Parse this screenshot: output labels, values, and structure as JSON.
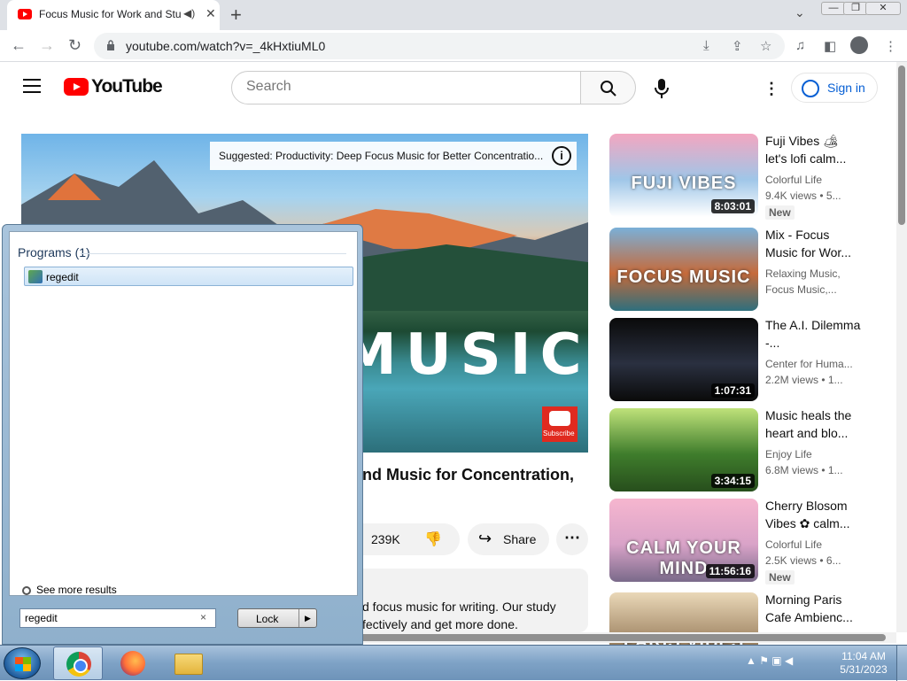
{
  "browser": {
    "tab_title": "Focus Music for Work and Stu",
    "speaker": "◀)",
    "close": "✕",
    "new_tab": "+",
    "url": "youtube.com/watch?v=_4kHxtiuML0"
  },
  "youtube": {
    "logo_text": "YouTube",
    "search_placeholder": "Search",
    "signin_label": "Sign in",
    "suggested_text": "Suggested: Productivity: Deep Focus Music for Better Concentratio...",
    "suggested_info": "i",
    "player_big_word": "MUSIC",
    "subscribe_label": "Subscribe",
    "video_title": "nd Music for Concentration,",
    "likes": "239K",
    "share_label": "Share",
    "description": [
      "d focus music for writing. Our study",
      "fectively and get more done."
    ]
  },
  "recommendations": [
    {
      "title": "Fuji Vibes 🏕 let's lofi calm...",
      "channel": "Colorful Life",
      "meta": "9.4K views • 5...",
      "duration": "8:03:01",
      "badge": "New",
      "overlay": "FUJI VIBES",
      "colors": [
        "#f3a6c0",
        "#9fc6e8",
        "#ffffff"
      ]
    },
    {
      "title": "Mix - Focus Music for Wor...",
      "channel": "Relaxing Music,",
      "meta": "Focus Music,...",
      "duration": "",
      "badge": "",
      "overlay": "FOCUS MUSIC",
      "colors": [
        "#7ab0d8",
        "#c66a3a",
        "#2e6f7d"
      ]
    },
    {
      "title": "The A.I. Dilemma -...",
      "channel": "Center for Huma...",
      "meta": "2.2M views • 1...",
      "duration": "1:07:31",
      "badge": "",
      "overlay": "",
      "colors": [
        "#0a0a0a",
        "#2a3040",
        "#0a0a0a"
      ]
    },
    {
      "title": "Music heals the heart and blo...",
      "channel": "Enjoy Life",
      "meta": "6.8M views • 1...",
      "duration": "3:34:15",
      "badge": "",
      "overlay": "",
      "colors": [
        "#bfe27a",
        "#3f7d2c",
        "#274e1c"
      ]
    },
    {
      "title": "Cherry Blosom Vibes ✿ calm...",
      "channel": "Colorful Life",
      "meta": "2.5K views • 6...",
      "duration": "11:56:16",
      "badge": "New",
      "overlay": "CALM YOUR MIND",
      "colors": [
        "#f6b6cf",
        "#d9a3c8",
        "#7a6a8a"
      ]
    },
    {
      "title": "Morning Paris Cafe Ambienc...",
      "channel": "",
      "meta": "",
      "duration": "",
      "badge": "",
      "overlay": "PARIS VIBES",
      "colors": [
        "#ead8b8",
        "#a58b6a",
        "#4b3a2a"
      ]
    }
  ],
  "start_menu": {
    "programs_header": "Programs (1)",
    "program_item": "regedit",
    "see_more": "See more results",
    "search_value": "regedit",
    "clear": "×",
    "lock_label": "Lock",
    "lock_arrow": "▶"
  },
  "taskbar": {
    "clock_time": "11:04 AM",
    "clock_date": "5/31/2023",
    "tray_icons": "▲ ⚑ ▣ ◀"
  }
}
